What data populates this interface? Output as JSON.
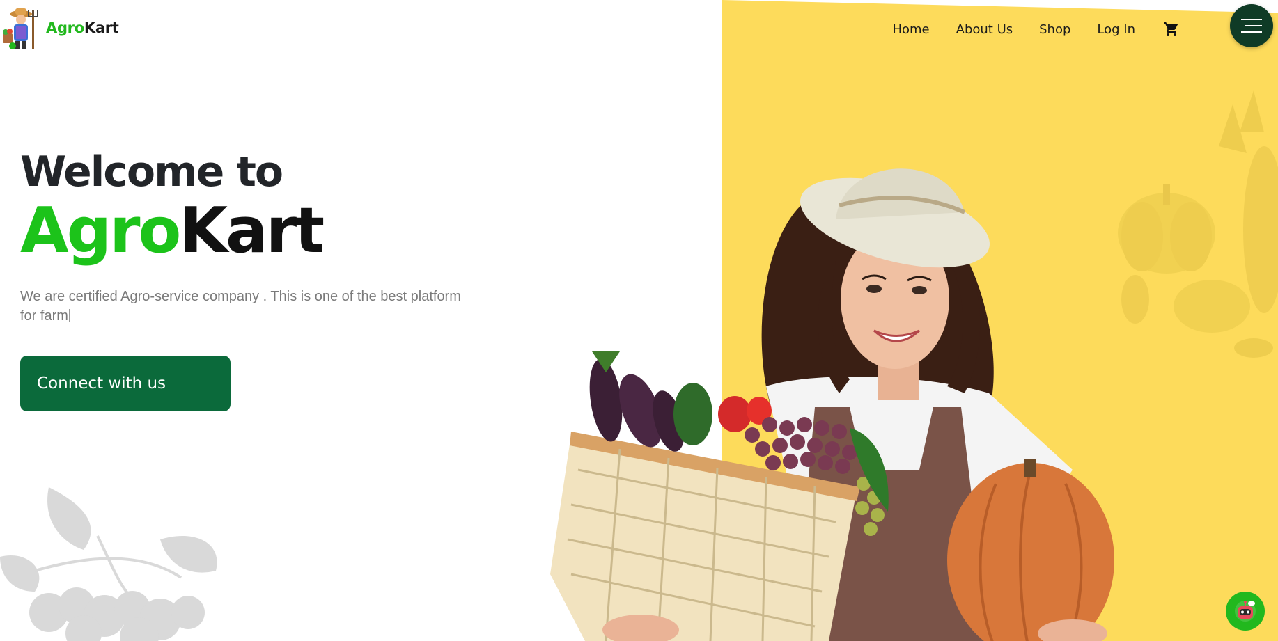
{
  "brand": {
    "name_part1": "Agro",
    "name_part2": "Kart"
  },
  "nav": {
    "items": [
      {
        "label": "Home"
      },
      {
        "label": "About Us"
      },
      {
        "label": "Shop"
      },
      {
        "label": "Log In"
      }
    ],
    "cart_icon": "cart-icon",
    "menu_icon": "hamburger-menu-icon"
  },
  "hero": {
    "welcome": "Welcome to",
    "brand_green": "Agro",
    "brand_dark": "Kart",
    "description": "We are certified Agro-service company . This is one of the best platform for farm",
    "cta_label": "Connect with us"
  },
  "chatbot": {
    "icon": "robot-icon"
  },
  "colors": {
    "brand_green": "#1cc31a",
    "cta_green": "#0b6a3b",
    "panel_yellow": "#fddb5b",
    "menu_dark": "#0f3b26"
  }
}
